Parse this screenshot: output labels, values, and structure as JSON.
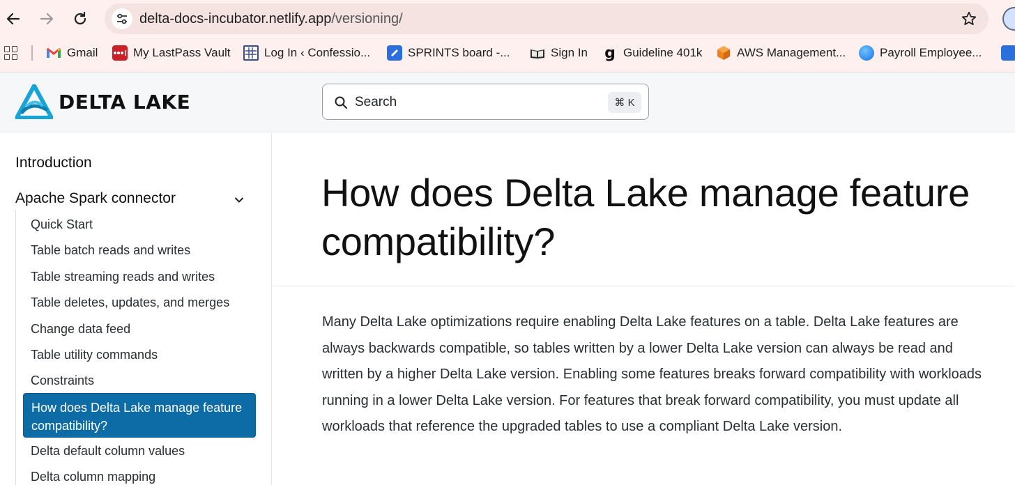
{
  "browser": {
    "url_host": "delta-docs-incubator.netlify.app",
    "url_path": "/versioning/",
    "bookmarks": [
      {
        "label": "Gmail",
        "icon": "gmail-icon"
      },
      {
        "label": "My LastPass Vault",
        "icon": "lastpass-icon"
      },
      {
        "label": "Log In ‹ Confessio...",
        "icon": "grid-site-icon"
      },
      {
        "label": "SPRINTS board -...",
        "icon": "jira-icon"
      },
      {
        "label": "Sign In",
        "icon": "book-icon"
      },
      {
        "label": "Guideline 401k",
        "icon": "guideline-icon"
      },
      {
        "label": "AWS Management...",
        "icon": "aws-icon"
      },
      {
        "label": "Payroll Employee...",
        "icon": "payroll-icon"
      }
    ]
  },
  "header": {
    "logo_text": "DELTA LAKE",
    "search_placeholder": "Search",
    "search_shortcut": "⌘ K"
  },
  "sidebar": {
    "section_intro": "Introduction",
    "section_spark": "Apache Spark connector",
    "items": [
      "Quick Start",
      "Table batch reads and writes",
      "Table streaming reads and writes",
      "Table deletes, updates, and merges",
      "Change data feed",
      "Table utility commands",
      "Constraints",
      "How does Delta Lake manage feature compatibility?",
      "Delta default column values",
      "Delta column mapping"
    ],
    "active_index": 7
  },
  "main": {
    "title": "How does Delta Lake manage feature compatibility?",
    "paragraph": "Many Delta Lake optimizations require enabling Delta Lake features on a table. Delta Lake features are always backwards compatible, so tables written by a lower Delta Lake version can always be read and written by a higher Delta Lake version. Enabling some features breaks forward compatibility with workloads running in a lower Delta Lake version. For features that break forward compatibility, you must update all workloads that reference the upgraded tables to use a compliant Delta Lake version."
  },
  "colors": {
    "accent": "#0d6ba6",
    "chrome_bg": "#fdf0ef"
  }
}
